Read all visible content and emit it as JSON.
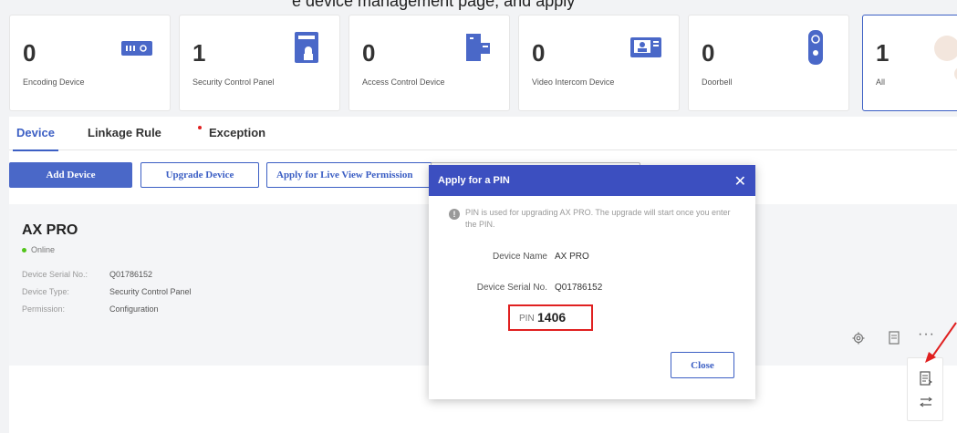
{
  "caption": "e device management page, and apply",
  "cards": [
    {
      "count": "0",
      "label": "Encoding Device",
      "icon": "nvr-icon"
    },
    {
      "count": "1",
      "label": "Security Control Panel",
      "icon": "panel-icon"
    },
    {
      "count": "0",
      "label": "Access Control Device",
      "icon": "access-icon"
    },
    {
      "count": "0",
      "label": "Video Intercom Device",
      "icon": "intercom-icon"
    },
    {
      "count": "0",
      "label": "Doorbell",
      "icon": "doorbell-icon"
    },
    {
      "count": "1",
      "label": "All",
      "icon": ""
    }
  ],
  "tabs": {
    "device": "Device",
    "linkage": "Linkage Rule",
    "exception": "Exception"
  },
  "toolbar": {
    "add": "Add Device",
    "upgrade": "Upgrade Device",
    "live_view": "Apply for Live View Permission"
  },
  "device": {
    "name": "AX PRO",
    "status": "Online",
    "serial_label": "Device Serial No.:",
    "serial": "Q01786152",
    "type_label": "Device Type:",
    "type": "Security Control Panel",
    "perm_label": "Permission:",
    "perm": "Configuration"
  },
  "modal": {
    "title": "Apply for a PIN",
    "info": "PIN is used for upgrading AX PRO. The upgrade will start once you enter the PIN.",
    "name_label": "Device Name",
    "name_value": "AX PRO",
    "serial_label": "Device Serial No.",
    "serial_value": "Q01786152",
    "pin_label": "PIN",
    "pin_value": "1406",
    "close": "Close"
  },
  "colors": {
    "accent": "#3c5fc4",
    "modal_header": "#3c4fc0",
    "highlight": "#e02020",
    "online": "#52c41a"
  }
}
